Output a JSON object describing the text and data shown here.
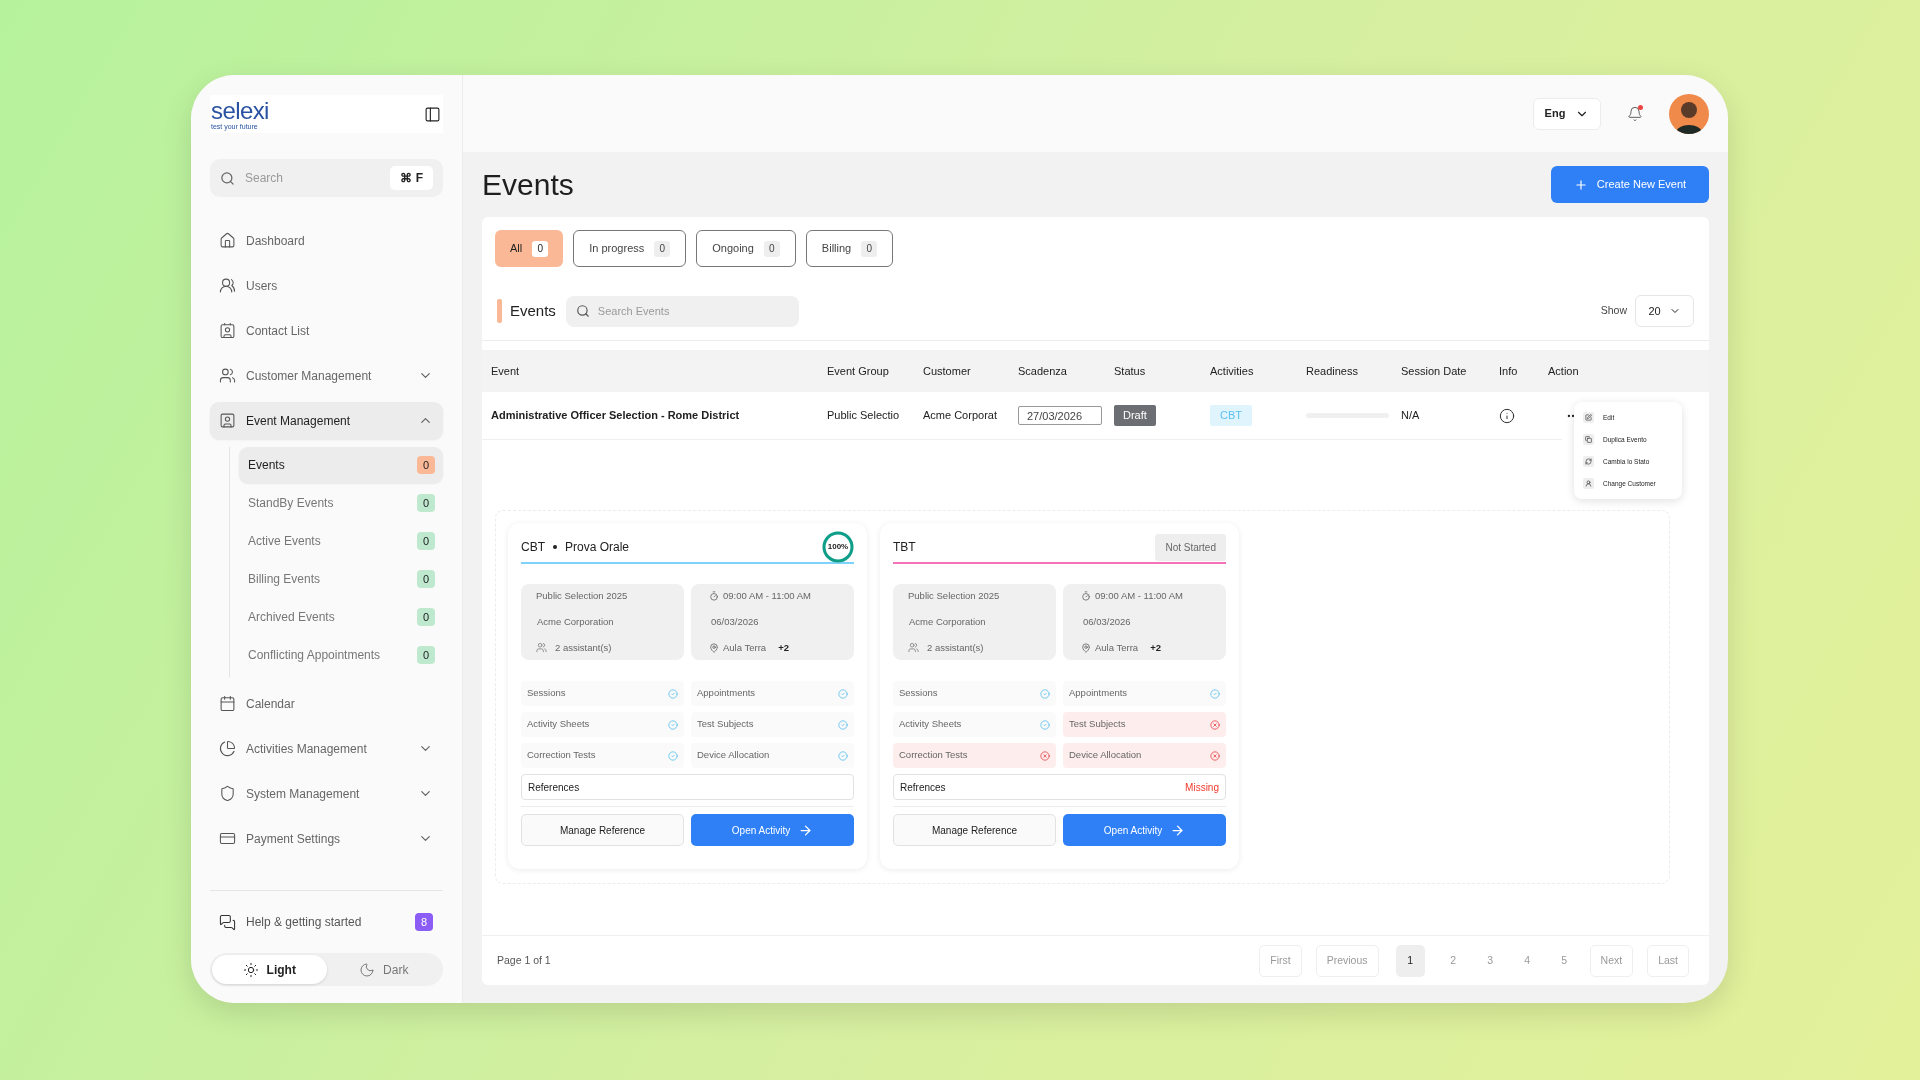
{
  "sidebar": {
    "logo": {
      "name": "selexi",
      "tagline": "test your future"
    },
    "search": {
      "placeholder": "Search",
      "shortcut": "⌘ F"
    },
    "items": [
      {
        "kind": "link",
        "label": "Dashboard",
        "selected": false
      },
      {
        "kind": "link",
        "label": "Users",
        "selected": false
      },
      {
        "kind": "link",
        "label": "Contact List",
        "selected": false
      },
      {
        "kind": "group",
        "label": "Customer Management",
        "selected": false,
        "expanded": false
      },
      {
        "kind": "group",
        "label": "Event Management",
        "selected": true,
        "expanded": true,
        "children": [
          {
            "label": "Events",
            "count": "0",
            "selected": true
          },
          {
            "label": "StandBy Events",
            "count": "0",
            "selected": false
          },
          {
            "label": "Active Events",
            "count": "0",
            "selected": false
          },
          {
            "label": "Billing Events",
            "count": "0",
            "selected": false
          },
          {
            "label": "Archived Events",
            "count": "0",
            "selected": false
          },
          {
            "label": "Conflicting Appointments",
            "count": "0",
            "selected": false
          }
        ]
      },
      {
        "kind": "link",
        "label": "Calendar",
        "selected": false
      },
      {
        "kind": "group",
        "label": "Activities Management",
        "selected": false,
        "expanded": false
      },
      {
        "kind": "group",
        "label": "System Management",
        "selected": false,
        "expanded": false
      },
      {
        "kind": "group",
        "label": "Payment Settings",
        "selected": false,
        "expanded": false
      }
    ],
    "help": {
      "label": "Help & getting started",
      "count": "8"
    },
    "theme": [
      {
        "label": "Light",
        "kind": "sun",
        "selected": true
      },
      {
        "label": "Dark",
        "kind": "moon",
        "selected": false
      }
    ]
  },
  "header": {
    "language": "Eng",
    "unread": true
  },
  "page": {
    "title": "Events",
    "create_button": "Create New Event"
  },
  "filter_tabs": [
    {
      "label": "All",
      "count": "0",
      "selected": true
    },
    {
      "label": "In progress",
      "count": "0",
      "selected": false
    },
    {
      "label": "Ongoing",
      "count": "0",
      "selected": false
    },
    {
      "label": "Billing",
      "count": "0",
      "selected": false
    }
  ],
  "events": {
    "title": "Events",
    "search_placeholder": "Search Events",
    "show_label": "Show",
    "page_size": "20",
    "columns": [
      "Event",
      "Event Group",
      "Customer",
      "Scadenza",
      "Status",
      "Activities",
      "Readiness",
      "Session Date",
      "Info",
      "Action"
    ],
    "rows": [
      {
        "event": "Administrative Officer Selection - Rome District",
        "event_group": "Public Selectio",
        "customer": "Acme Corporat",
        "scadenza": "27/03/2026",
        "status": "Draft",
        "activity": "CBT",
        "readiness": {
          "level": 0
        },
        "session_date": "N/A"
      }
    ],
    "action_menu": [
      {
        "label": "Edit"
      },
      {
        "label": "Duplica Evento"
      },
      {
        "label": "Cambia lo Stato"
      },
      {
        "label": "Change Customer"
      }
    ],
    "activity_cards": [
      {
        "type": "CBT",
        "subtitle": "Prova Orale",
        "color": "#7dd3fc",
        "progress": {
          "level": 1,
          "label": "100%"
        },
        "group": "Public Selection 2025",
        "customer": "Acme Corporation",
        "assistants": "2 assistant(s)",
        "time": "09:00 AM - 11:00 AM",
        "date": "06/03/2026",
        "location": "Aula Terra",
        "extra_locations": "+2",
        "checks": [
          {
            "label": "Sessions",
            "ok": true
          },
          {
            "label": "Appointments",
            "ok": true
          },
          {
            "label": "Activity Sheets",
            "ok": true
          },
          {
            "label": "Test Subjects",
            "ok": true
          },
          {
            "label": "Correction Tests",
            "ok": true
          },
          {
            "label": "Device Allocation",
            "ok": true
          }
        ],
        "references": {
          "label": "References"
        },
        "buttons": [
          "Manage Reference",
          "Open Activity"
        ]
      },
      {
        "type": "TBT",
        "color": "#f472b6",
        "status": "Not Started",
        "group": "Public Selection 2025",
        "customer": "Acme Corporation",
        "assistants": "2 assistant(s)",
        "time": "09:00 AM - 11:00 AM",
        "date": "06/03/2026",
        "location": "Aula Terra",
        "extra_locations": "+2",
        "checks": [
          {
            "label": "Sessions",
            "ok": true
          },
          {
            "label": "Appointments",
            "ok": true
          },
          {
            "label": "Activity Sheets",
            "ok": true
          },
          {
            "label": "Test Subjects",
            "ok": false
          },
          {
            "label": "Correction Tests",
            "ok": false
          },
          {
            "label": "Device Allocation",
            "ok": false
          }
        ],
        "references": {
          "label": "Refrences",
          "status": "Missing"
        },
        "buttons": [
          "Manage Reference",
          "Open Activity"
        ]
      }
    ]
  },
  "pagination": {
    "summary": "Page 1 of 1",
    "buttons": [
      {
        "label": "First",
        "kind": "nav",
        "disabled": true,
        "selected": false
      },
      {
        "label": "Previous",
        "kind": "nav",
        "disabled": true,
        "selected": false
      },
      {
        "label": "1",
        "kind": "page",
        "disabled": false,
        "selected": true
      },
      {
        "label": "2",
        "kind": "page",
        "disabled": true,
        "selected": false
      },
      {
        "label": "3",
        "kind": "page",
        "disabled": true,
        "selected": false
      },
      {
        "label": "4",
        "kind": "page",
        "disabled": true,
        "selected": false
      },
      {
        "label": "5",
        "kind": "page",
        "disabled": true,
        "selected": false
      },
      {
        "label": "Next",
        "kind": "nav",
        "disabled": true,
        "selected": false
      },
      {
        "label": "Last",
        "kind": "nav",
        "disabled": true,
        "selected": false
      }
    ]
  }
}
